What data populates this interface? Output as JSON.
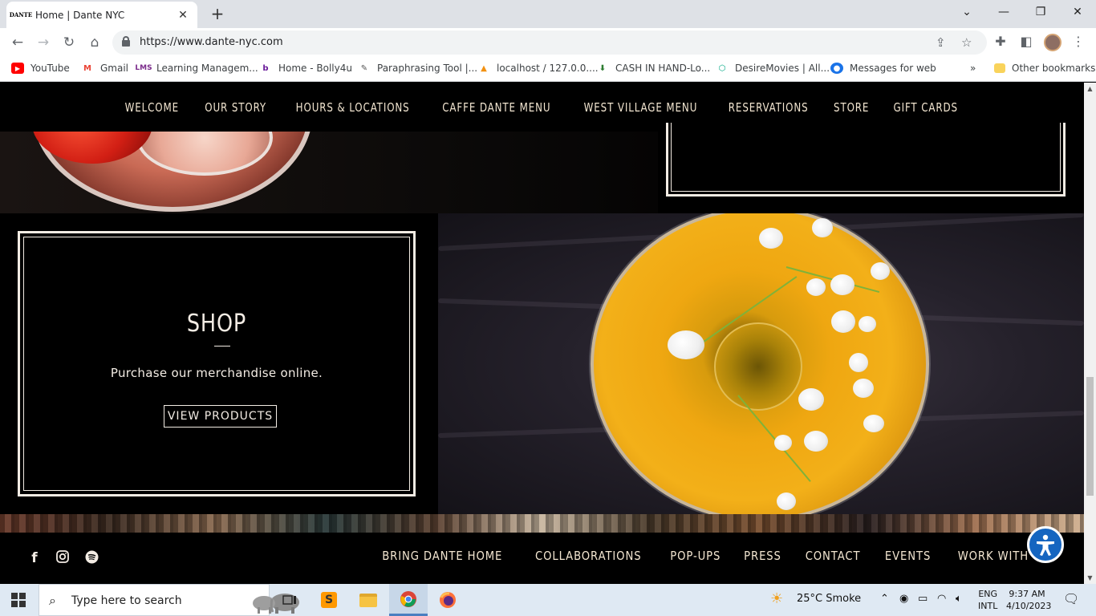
{
  "browser": {
    "tab_title": "Home | Dante NYC",
    "tab_favicon": "DANTE",
    "url": "https://www.dante-nyc.com",
    "bookmarks": [
      {
        "label": "YouTube",
        "icon": "youtube-icon",
        "color": "#ff0000"
      },
      {
        "label": "Gmail",
        "icon": "gmail-icon",
        "color": "#ea4335"
      },
      {
        "label": "Learning Managem...",
        "icon": "lms-icon",
        "color": "#7b2c8b"
      },
      {
        "label": "Home - Bolly4u",
        "icon": "bolly4u-icon",
        "color": "#6a1b9a"
      },
      {
        "label": "Paraphrasing Tool |...",
        "icon": "quill-icon",
        "color": "#555555"
      },
      {
        "label": "localhost / 127.0.0....",
        "icon": "phpmyadmin-icon",
        "color": "#f29111"
      },
      {
        "label": "CASH IN HAND-Lo...",
        "icon": "cash-icon",
        "color": "#2e7d32"
      },
      {
        "label": "DesireMovies | All...",
        "icon": "desiremovies-icon",
        "color": "#00a884"
      },
      {
        "label": "Messages for web",
        "icon": "messages-icon",
        "color": "#1a73e8"
      }
    ],
    "bookmarks_overflow": "»",
    "other_bookmarks": "Other bookmarks"
  },
  "site": {
    "nav": [
      "WELCOME",
      "OUR STORY",
      "HOURS & LOCATIONS",
      "CAFFE DANTE MENU",
      "WEST VILLAGE MENU",
      "RESERVATIONS",
      "STORE",
      "GIFT CARDS"
    ],
    "shop": {
      "title": "SHOP",
      "description": "Purchase our merchandise online.",
      "button": "VIEW PRODUCTS"
    },
    "footer_nav": [
      "BRING DANTE HOME",
      "COLLABORATIONS",
      "POP-UPS",
      "PRESS",
      "CONTACT",
      "EVENTS",
      "WORK WITH US"
    ],
    "social": [
      "facebook-icon",
      "instagram-icon",
      "spotify-icon"
    ]
  },
  "taskbar": {
    "search_placeholder": "Type here to search",
    "weather": "25°C  Smoke",
    "lang_1": "ENG",
    "lang_2": "INTL",
    "time": "9:37 AM",
    "date": "4/10/2023"
  },
  "colors": {
    "nav_text": "#f3e6d1",
    "page_bg": "#000000",
    "card_border": "#f3ece4",
    "accessibility": "#1565c0"
  }
}
